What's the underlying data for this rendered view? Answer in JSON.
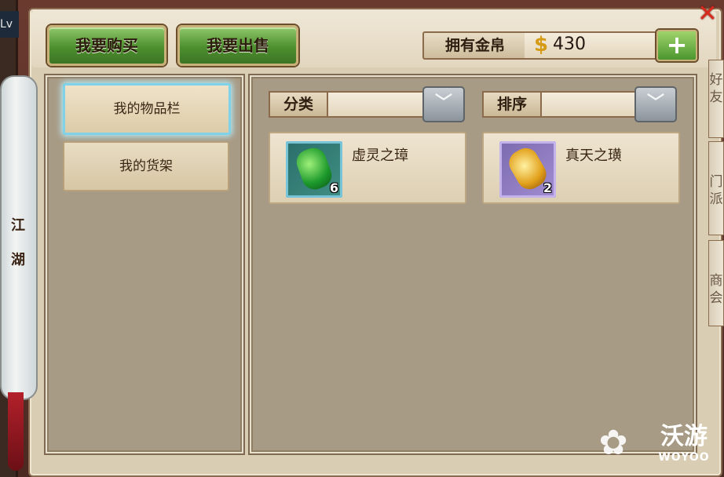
{
  "window": {
    "close_symbol": "✕",
    "level_badge": "Lv"
  },
  "left_scroll": {
    "label_line1": "江",
    "label_line2": "湖"
  },
  "toolbar": {
    "buy_label": "我要购买",
    "sell_label": "我要出售",
    "gold_label": "拥有金帛",
    "gold_value": "430",
    "add_symbol": "+"
  },
  "sidebar": {
    "items": [
      {
        "label": "我的物品栏",
        "selected": true
      },
      {
        "label": "我的货架",
        "selected": false
      }
    ]
  },
  "filters": {
    "category_label": "分类",
    "category_value": "",
    "sort_label": "排序",
    "sort_value": ""
  },
  "items": [
    {
      "name": "虚灵之璋",
      "count": "6",
      "icon": "jade-token-icon"
    },
    {
      "name": "真天之璜",
      "count": "2",
      "icon": "gold-pendant-icon"
    }
  ],
  "side_tabs": [
    {
      "text": "好友"
    },
    {
      "text": "门派"
    },
    {
      "text": "商会"
    }
  ],
  "watermark": {
    "cn": "沃游",
    "en": "WOYOO"
  },
  "colors": {
    "accent_green": "#4d8f2f",
    "gold": "#d59b16",
    "close_red": "#d62a1c"
  }
}
